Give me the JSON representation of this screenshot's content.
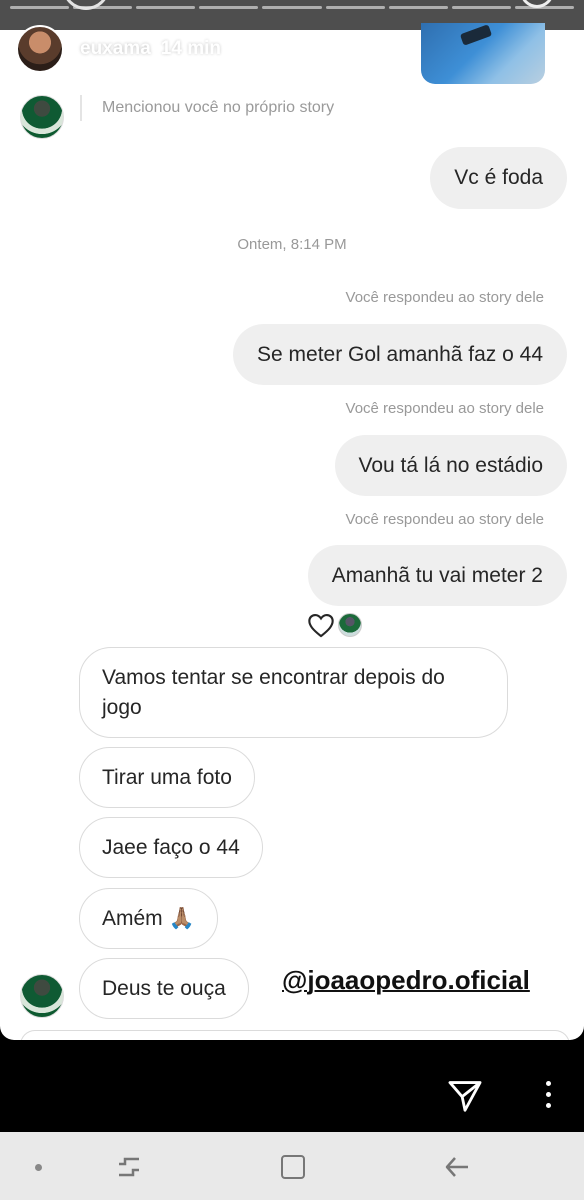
{
  "story": {
    "username": "euxama",
    "time_ago": "14 min"
  },
  "mention": {
    "text": "Mencionou você no próprio story"
  },
  "messages_top": {
    "sent_1": "Vc é foda",
    "timestamp": "Ontem, 8:14 PM"
  },
  "replies": [
    {
      "note": "Você respondeu ao story dele",
      "text": "Se meter Gol amanhã faz o 44"
    },
    {
      "note": "Você respondeu ao story dele",
      "text": "Vou tá lá no estádio"
    },
    {
      "note": "Você respondeu ao story dele",
      "text": "Amanhã tu vai meter 2"
    }
  ],
  "received": [
    "Vamos tentar se encontrar depois do jogo",
    "Tirar uma foto",
    "Jaee faço o 44",
    "Amém 🙏🏽",
    "Deus te ouça"
  ],
  "watermark": "@joaaopedro.oficial",
  "colors": {
    "sent_bubble": "#efefef",
    "recv_border": "#dbdbdb",
    "meta_text": "#999999",
    "nav_bg": "#e9e9e9"
  },
  "icons": {
    "reaction": "heart-icon",
    "send": "paper-plane-icon",
    "more": "vertical-dots-icon",
    "nav_recent": "recent-apps-icon",
    "nav_home": "home-icon",
    "nav_back": "back-arrow-icon"
  }
}
